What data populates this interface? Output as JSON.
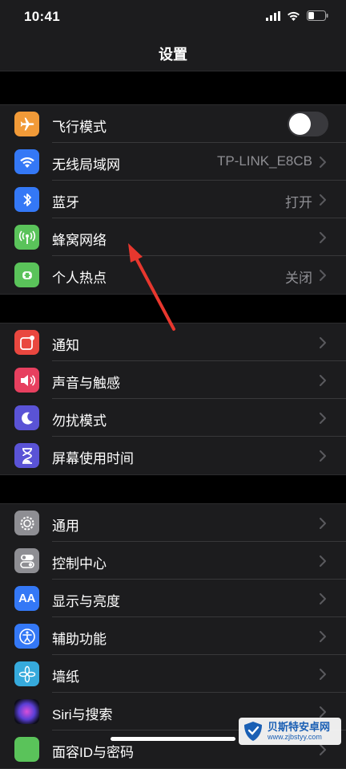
{
  "status_bar": {
    "time": "10:41"
  },
  "nav": {
    "title": "设置"
  },
  "groups": [
    {
      "rows": [
        {
          "label": "飞行模式",
          "value": "",
          "icon": "airplane-icon",
          "color": "#f19a38",
          "control": "toggle",
          "toggle_on": false
        },
        {
          "label": "无线局域网",
          "value": "TP-LINK_E8CB",
          "icon": "wifi-icon",
          "color": "#3478f6",
          "control": "chevron"
        },
        {
          "label": "蓝牙",
          "value": "打开",
          "icon": "bluetooth-icon",
          "color": "#3478f6",
          "control": "chevron"
        },
        {
          "label": "蜂窝网络",
          "value": "",
          "icon": "cellular-icon",
          "color": "#5ac35a",
          "control": "chevron"
        },
        {
          "label": "个人热点",
          "value": "关闭",
          "icon": "hotspot-icon",
          "color": "#5ac35a",
          "control": "chevron"
        }
      ]
    },
    {
      "rows": [
        {
          "label": "通知",
          "value": "",
          "icon": "notifications-icon",
          "color": "#e9473f",
          "control": "chevron"
        },
        {
          "label": "声音与触感",
          "value": "",
          "icon": "sound-icon",
          "color": "#e7405f",
          "control": "chevron"
        },
        {
          "label": "勿扰模式",
          "value": "",
          "icon": "moon-icon",
          "color": "#5a53d6",
          "control": "chevron"
        },
        {
          "label": "屏幕使用时间",
          "value": "",
          "icon": "hourglass-icon",
          "color": "#5a53d6",
          "control": "chevron"
        }
      ]
    },
    {
      "rows": [
        {
          "label": "通用",
          "value": "",
          "icon": "gear-icon",
          "color": "#8e8e93",
          "control": "chevron"
        },
        {
          "label": "控制中心",
          "value": "",
          "icon": "control-center-icon",
          "color": "#8e8e93",
          "control": "chevron"
        },
        {
          "label": "显示与亮度",
          "value": "",
          "icon": "display-icon",
          "color": "#3478f6",
          "control": "chevron"
        },
        {
          "label": "辅助功能",
          "value": "",
          "icon": "accessibility-icon",
          "color": "#3478f6",
          "control": "chevron"
        },
        {
          "label": "墙纸",
          "value": "",
          "icon": "wallpaper-icon",
          "color": "#36aadc",
          "control": "chevron"
        },
        {
          "label": "Siri与搜索",
          "value": "",
          "icon": "siri-icon",
          "color": "#1a1a2e",
          "control": "chevron"
        },
        {
          "label": "面容ID与密码",
          "value": "",
          "icon": "faceid-icon",
          "color": "#5ac35a",
          "control": "chevron"
        }
      ]
    }
  ],
  "watermark": {
    "title": "贝斯特安卓网",
    "url": "www.zjbstyy.com"
  }
}
